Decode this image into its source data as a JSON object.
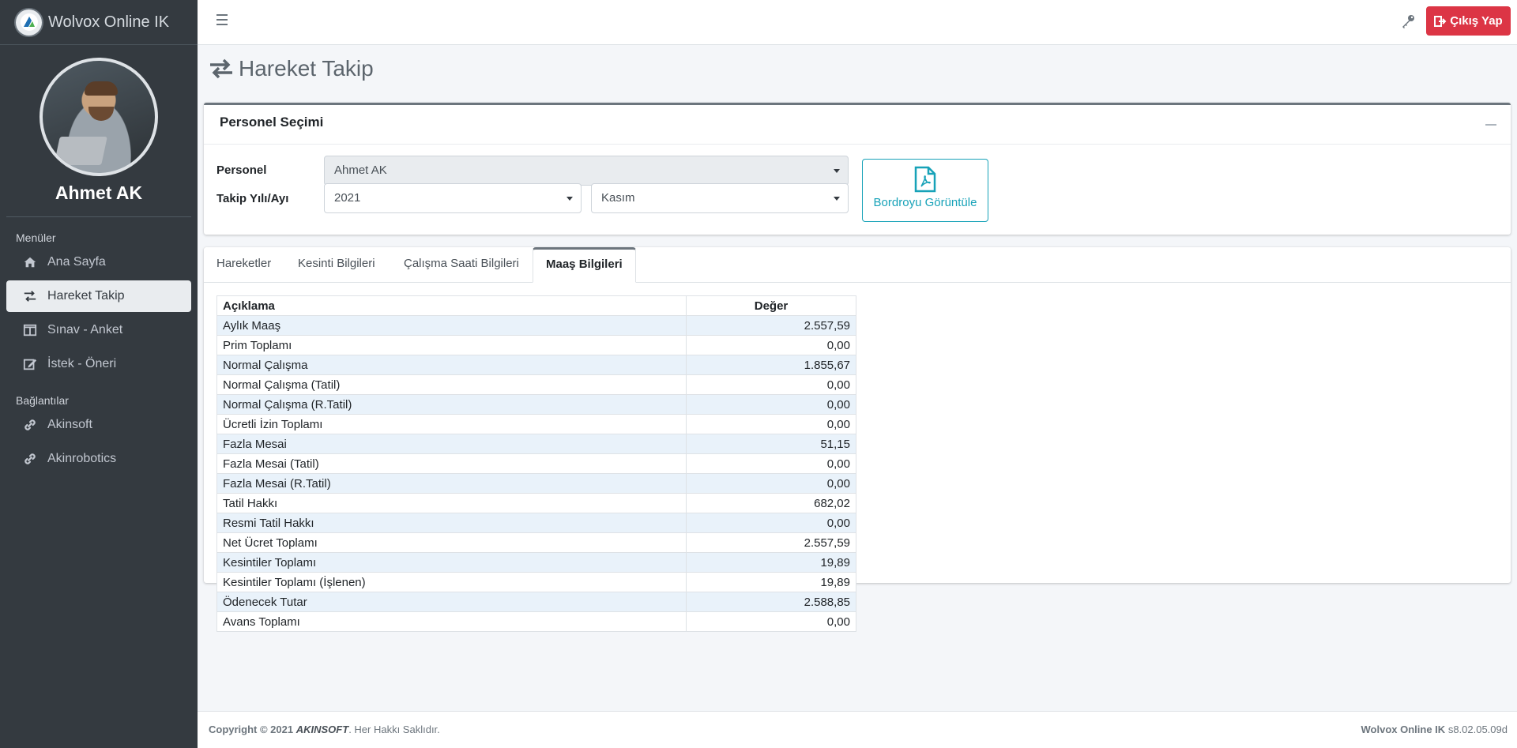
{
  "app": {
    "brand": "Wolvox Online IK"
  },
  "user": {
    "name": "Ahmet AK"
  },
  "sidebar": {
    "menus_header": "Menüler",
    "items": [
      {
        "label": "Ana Sayfa",
        "icon": "home-icon"
      },
      {
        "label": "Hareket Takip",
        "icon": "exchange-icon",
        "active": true
      },
      {
        "label": "Sınav - Anket",
        "icon": "columns-icon"
      },
      {
        "label": "İstek - Öneri",
        "icon": "edit-icon"
      }
    ],
    "links_header": "Bağlantılar",
    "links": [
      {
        "label": "Akinsoft",
        "icon": "link-icon"
      },
      {
        "label": "Akinrobotics",
        "icon": "link-icon"
      }
    ]
  },
  "navbar": {
    "logout_label": "Çıkış Yap"
  },
  "page": {
    "title": "Hareket Takip"
  },
  "selection": {
    "title": "Personel Seçimi",
    "personel_label": "Personel",
    "personel_value": "Ahmet AK",
    "period_label": "Takip Yılı/Ayı",
    "year_value": "2021",
    "month_value": "Kasım",
    "pdf_button": "Bordroyu Görüntüle"
  },
  "tabs": [
    {
      "label": "Hareketler"
    },
    {
      "label": "Kesinti Bilgileri"
    },
    {
      "label": "Çalışma Saati Bilgileri"
    },
    {
      "label": "Maaş Bilgileri",
      "active": true
    }
  ],
  "table": {
    "headers": [
      "Açıklama",
      "Değer"
    ],
    "rows": [
      [
        "Aylık Maaş",
        "2.557,59"
      ],
      [
        "Prim Toplamı",
        "0,00"
      ],
      [
        "Normal Çalışma",
        "1.855,67"
      ],
      [
        "Normal Çalışma (Tatil)",
        "0,00"
      ],
      [
        "Normal Çalışma (R.Tatil)",
        "0,00"
      ],
      [
        "Ücretli İzin Toplamı",
        "0,00"
      ],
      [
        "Fazla Mesai",
        "51,15"
      ],
      [
        "Fazla Mesai (Tatil)",
        "0,00"
      ],
      [
        "Fazla Mesai (R.Tatil)",
        "0,00"
      ],
      [
        "Tatil Hakkı",
        "682,02"
      ],
      [
        "Resmi Tatil Hakkı",
        "0,00"
      ],
      [
        "Net Ücret Toplamı",
        "2.557,59"
      ],
      [
        "Kesintiler Toplamı",
        "19,89"
      ],
      [
        "Kesintiler Toplamı (İşlenen)",
        "19,89"
      ],
      [
        "Ödenecek Tutar",
        "2.588,85"
      ],
      [
        "Avans Toplamı",
        "0,00"
      ]
    ]
  },
  "footer": {
    "copyright": "Copyright © 2021",
    "company": "AKINSOFT",
    "rights": ". Her Hakkı Saklıdır.",
    "product": "Wolvox Online IK",
    "version": "s8.02.05.09d"
  },
  "colors": {
    "sidebar": "#343a40",
    "danger": "#dc3545",
    "info": "#17a2b8",
    "stripe": "#e9f2fa"
  }
}
